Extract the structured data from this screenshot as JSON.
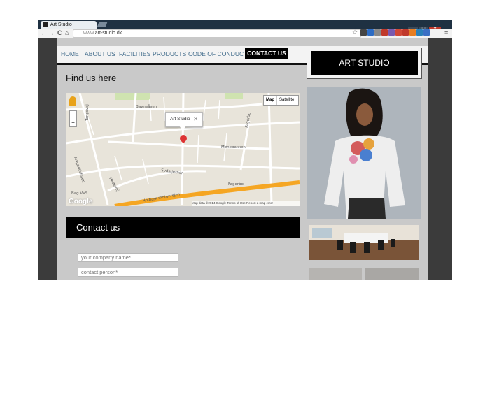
{
  "browser": {
    "tab_title": "Art Studio",
    "url_scheme": "www.",
    "url_host": "art-studio.dk",
    "window_controls": [
      "–",
      "□",
      "✕"
    ],
    "nav_icons": [
      "back-icon",
      "forward-icon",
      "reload-icon",
      "home-icon"
    ],
    "back_glyph": "←",
    "forward_glyph": "→",
    "reload_glyph": "C",
    "home_glyph": "⌂",
    "menu_glyph": "≡",
    "star_glyph": "☆"
  },
  "nav": {
    "home": "HOME",
    "about": "ABOUT US",
    "facilities": "FACILITIES",
    "products": "PRODUCTS",
    "conduct": "CODE OF CONDUCT",
    "contact": "CONTACT US"
  },
  "logo": "ART STUDIO",
  "find": {
    "title": "Find us here"
  },
  "map": {
    "type_map": "Map",
    "type_satellite": "Satellite",
    "infowindow_title": "Art Studio",
    "close_glyph": "✕",
    "zoom_in": "+",
    "zoom_out": "−",
    "attribution": "Map data ©2014 Google    Terms of Use    Report a map error",
    "google_logo": "Google",
    "streets": [
      "Bavneåsen",
      "Mønebakken",
      "Sydstjernen",
      "Fagerbo",
      "Fagerbo",
      "Magnoliebuen",
      "Hedevej",
      "Holbæk motorvejen",
      "Bag VVS",
      "Tangsvej"
    ]
  },
  "contact": {
    "title": "Contact us",
    "company_placeholder": "your company name*",
    "person_placeholder": "contact person*"
  },
  "colors": {
    "accent_link": "#3f6a8a",
    "nav_active_bg": "#000000",
    "page_bg": "#c9c9c9",
    "frame_bg": "#3b3b3b"
  }
}
